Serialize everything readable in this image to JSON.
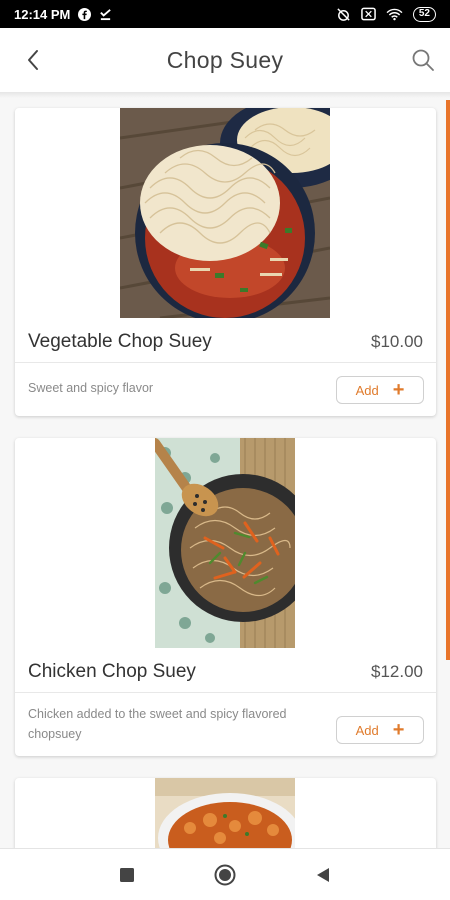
{
  "status_bar": {
    "time": "12:14 PM",
    "battery": "52",
    "icons": [
      "facebook-icon",
      "download-done-icon",
      "alarm-off-icon",
      "sim-icon",
      "wifi-icon",
      "battery-icon"
    ]
  },
  "header": {
    "title": "Chop Suey",
    "back_icon": "chevron-left-icon",
    "search_icon": "search-icon"
  },
  "colors": {
    "accent": "#e07b2c",
    "scroll_indicator": "#e8742a",
    "background": "#f7f7f7"
  },
  "menu_items": [
    {
      "name": "Vegetable Chop Suey",
      "price": "$10.00",
      "description": "Sweet and spicy flavor",
      "add_label": "Add"
    },
    {
      "name": "Chicken Chop Suey",
      "price": "$12.00",
      "description": "Chicken added to the sweet and spicy flavored chopsuey",
      "add_label": "Add"
    }
  ],
  "nav_bar": {
    "icons": [
      "recents-icon",
      "home-icon",
      "back-icon"
    ]
  }
}
